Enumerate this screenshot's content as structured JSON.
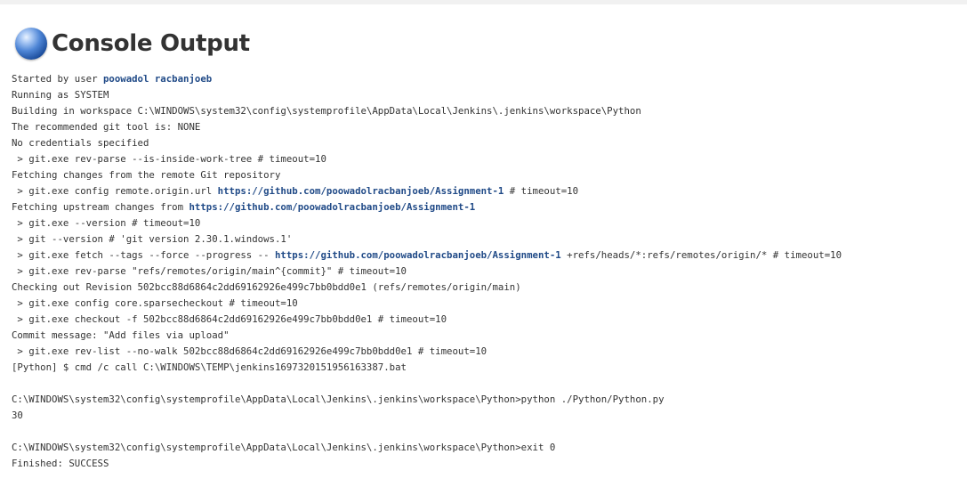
{
  "page": {
    "title": "Console Output",
    "icon": "blue-ball-icon",
    "status_color": "#3a73c8"
  },
  "console": {
    "link_color": "#204a87",
    "lines": [
      [
        {
          "t": "Started by user "
        },
        {
          "t": "poowadol racbanjoeb",
          "link": true
        }
      ],
      [
        {
          "t": "Running as SYSTEM"
        }
      ],
      [
        {
          "t": "Building in workspace C:\\WINDOWS\\system32\\config\\systemprofile\\AppData\\Local\\Jenkins\\.jenkins\\workspace\\Python"
        }
      ],
      [
        {
          "t": "The recommended git tool is: NONE"
        }
      ],
      [
        {
          "t": "No credentials specified"
        }
      ],
      [
        {
          "t": " > git.exe rev-parse --is-inside-work-tree # timeout=10"
        }
      ],
      [
        {
          "t": "Fetching changes from the remote Git repository"
        }
      ],
      [
        {
          "t": " > git.exe config remote.origin.url "
        },
        {
          "t": "https://github.com/poowadolracbanjoeb/Assignment-1",
          "link": true
        },
        {
          "t": " # timeout=10"
        }
      ],
      [
        {
          "t": "Fetching upstream changes from "
        },
        {
          "t": "https://github.com/poowadolracbanjoeb/Assignment-1",
          "link": true
        }
      ],
      [
        {
          "t": " > git.exe --version # timeout=10"
        }
      ],
      [
        {
          "t": " > git --version # 'git version 2.30.1.windows.1'"
        }
      ],
      [
        {
          "t": " > git.exe fetch --tags --force --progress -- "
        },
        {
          "t": "https://github.com/poowadolracbanjoeb/Assignment-1",
          "link": true
        },
        {
          "t": " +refs/heads/*:refs/remotes/origin/* # timeout=10"
        }
      ],
      [
        {
          "t": " > git.exe rev-parse \"refs/remotes/origin/main^{commit}\" # timeout=10"
        }
      ],
      [
        {
          "t": "Checking out Revision 502bcc88d6864c2dd69162926e499c7bb0bdd0e1 (refs/remotes/origin/main)"
        }
      ],
      [
        {
          "t": " > git.exe config core.sparsecheckout # timeout=10"
        }
      ],
      [
        {
          "t": " > git.exe checkout -f 502bcc88d6864c2dd69162926e499c7bb0bdd0e1 # timeout=10"
        }
      ],
      [
        {
          "t": "Commit message: \"Add files via upload\""
        }
      ],
      [
        {
          "t": " > git.exe rev-list --no-walk 502bcc88d6864c2dd69162926e499c7bb0bdd0e1 # timeout=10"
        }
      ],
      [
        {
          "t": "[Python] $ cmd /c call C:\\WINDOWS\\TEMP\\jenkins1697320151956163387.bat"
        }
      ],
      [
        {
          "t": ""
        }
      ],
      [
        {
          "t": "C:\\WINDOWS\\system32\\config\\systemprofile\\AppData\\Local\\Jenkins\\.jenkins\\workspace\\Python>python ./Python/Python.py"
        }
      ],
      [
        {
          "t": "30"
        }
      ],
      [
        {
          "t": ""
        }
      ],
      [
        {
          "t": "C:\\WINDOWS\\system32\\config\\systemprofile\\AppData\\Local\\Jenkins\\.jenkins\\workspace\\Python>exit 0"
        }
      ],
      [
        {
          "t": "Finished: SUCCESS"
        }
      ]
    ]
  }
}
